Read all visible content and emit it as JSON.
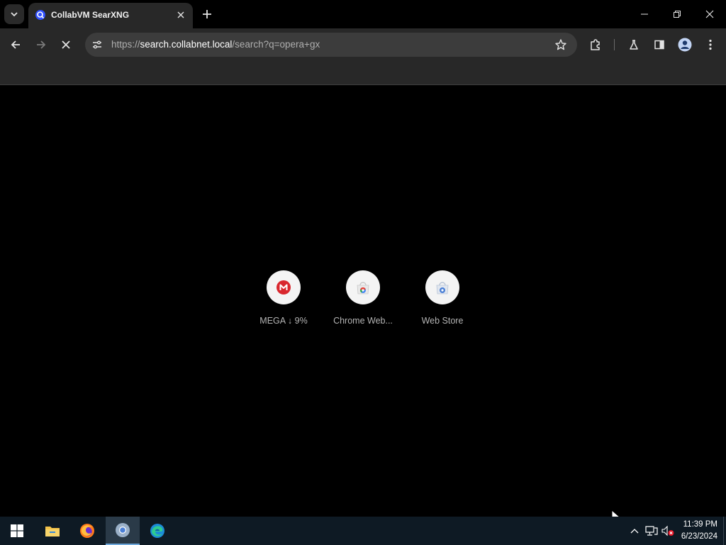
{
  "browser": {
    "tab": {
      "title": "CollabVM SearXNG"
    },
    "address": {
      "scheme": "https://",
      "host": "search.collabnet.local",
      "path": "/search?q=opera+gx"
    }
  },
  "shortcuts": [
    {
      "label": "MEGA ↓ 9%",
      "icon": "mega-icon"
    },
    {
      "label": "Chrome Web...",
      "icon": "chrome-web-store-icon"
    },
    {
      "label": "Web Store",
      "icon": "web-store-icon"
    }
  ],
  "taskbar": {
    "apps": [
      "windows-start-icon",
      "file-explorer-icon",
      "firefox-icon",
      "chrome-icon",
      "edge-icon"
    ],
    "clock": {
      "time": "11:39 PM",
      "date": "6/23/2024"
    }
  },
  "colors": {
    "mega_red": "#d9272e",
    "content_bg": "#000000",
    "toolbar_bg": "#282828",
    "taskbar_bg": "#0e1a24"
  }
}
